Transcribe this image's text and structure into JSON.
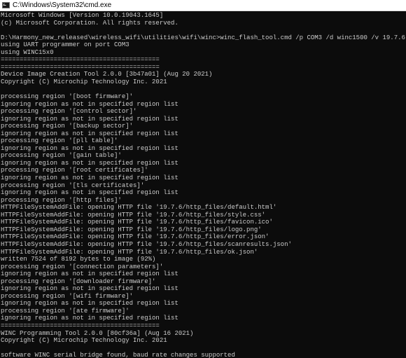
{
  "window": {
    "title": "C:\\Windows\\System32\\cmd.exe",
    "icon": "cmd-icon"
  },
  "colors": {
    "background": "#0c0c0c",
    "text": "#cccccc",
    "titlebar": "#ffffff"
  },
  "console": {
    "lines": [
      "Microsoft Windows [Version 10.0.19043.1645]",
      "(c) Microsoft Corporation. All rights reserved.",
      "",
      "D:\\Harmony_new_released\\wireless_wifi\\utilities\\wifi\\winc>winc_flash_tool.cmd /p COM3 /d winc1500 /v 19.7.6 /i http /w",
      "using UART programmer on port COM3",
      "using WINC15x0",
      "==========================================",
      "==========================================",
      "Device Image Creation Tool 2.0.0 [3b47a01] (Aug 20 2021)",
      "Copyright (C) Microchip Technology Inc. 2021",
      "",
      "processing region '[boot firmware]'",
      "ignoring region as not in specified region list",
      "processing region '[control sector]'",
      "ignoring region as not in specified region list",
      "processing region '[backup sector]'",
      "ignoring region as not in specified region list",
      "processing region '[pll table]'",
      "ignoring region as not in specified region list",
      "processing region '[gain table]'",
      "ignoring region as not in specified region list",
      "processing region '[root certificates]'",
      "ignoring region as not in specified region list",
      "processing region '[tls certificates]'",
      "ignoring region as not in specified region list",
      "processing region '[http files]'",
      "HTTPFileSystemAddFile: opening HTTP file '19.7.6/http_files/default.html'",
      "HTTPFileSystemAddFile: opening HTTP file '19.7.6/http_files/style.css'",
      "HTTPFileSystemAddFile: opening HTTP file '19.7.6/http_files/favicon.ico'",
      "HTTPFileSystemAddFile: opening HTTP file '19.7.6/http_files/logo.png'",
      "HTTPFileSystemAddFile: opening HTTP file '19.7.6/http_files/error.json'",
      "HTTPFileSystemAddFile: opening HTTP file '19.7.6/http_files/scanresults.json'",
      "HTTPFileSystemAddFile: opening HTTP file '19.7.6/http_files/ok.json'",
      "written 7524 of 8192 bytes to image (92%)",
      "processing region '[connection parameters]'",
      "ignoring region as not in specified region list",
      "processing region '[downloader firmware]'",
      "ignoring region as not in specified region list",
      "processing region '[wifi firmware]'",
      "ignoring region as not in specified region list",
      "processing region '[ate firmware]'",
      "ignoring region as not in specified region list",
      "==========================================",
      "WINC Programming Tool 2.0.0 [80cf36a] (Aug 16 2021)",
      "Copyright (C) Microchip Technology Inc. 2021",
      "",
      "software WINC serial bridge found, baud rate changes supported"
    ]
  }
}
